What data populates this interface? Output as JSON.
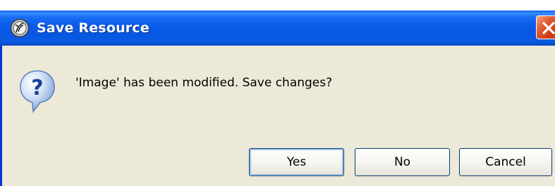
{
  "window": {
    "title": "Save Resource",
    "app_icon": "eclipse-app-icon",
    "close_icon": "close-icon"
  },
  "dialog": {
    "icon": "question-icon",
    "message": "'Image' has been modified. Save changes?"
  },
  "buttons": {
    "yes_label": "Yes",
    "no_label": "No",
    "cancel_label": "Cancel"
  },
  "colors": {
    "titlebar": "#0a5ae2",
    "dialog_background": "#ece9d8",
    "close_button": "#cf3d12"
  }
}
